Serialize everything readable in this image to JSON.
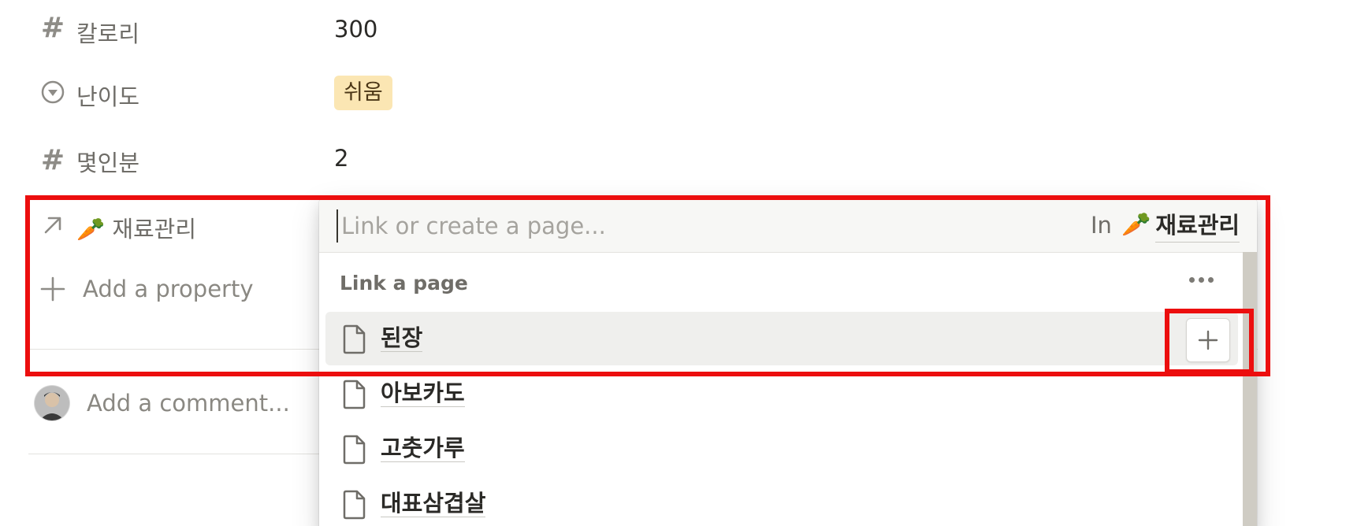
{
  "properties": [
    {
      "icon": "hash-icon",
      "label": "칼로리",
      "value": "300"
    },
    {
      "icon": "select-icon",
      "label": "난이도",
      "value": "쉬움",
      "tag_color": "#fbe6b3"
    },
    {
      "icon": "hash-icon",
      "label": "몇인분",
      "value": "2"
    },
    {
      "icon": "relation-arrow-icon",
      "label": "🥕 재료관리"
    }
  ],
  "add_property": {
    "icon": "plus-icon",
    "label": "Add a property"
  },
  "comment": {
    "placeholder": "Add a comment..."
  },
  "popup": {
    "search_placeholder": "Link or create a page...",
    "in_label": "In",
    "database_emoji": "🥕",
    "database_name": "재료관리",
    "section_title": "Link a page",
    "results": [
      {
        "title": "된장",
        "highlighted": true
      },
      {
        "title": "아보카도"
      },
      {
        "title": "고춧가루"
      },
      {
        "title": "대표삼겹살"
      }
    ]
  },
  "colors": {
    "highlight": "#ec0e0e",
    "tag_bg": "#fbe6b3"
  }
}
